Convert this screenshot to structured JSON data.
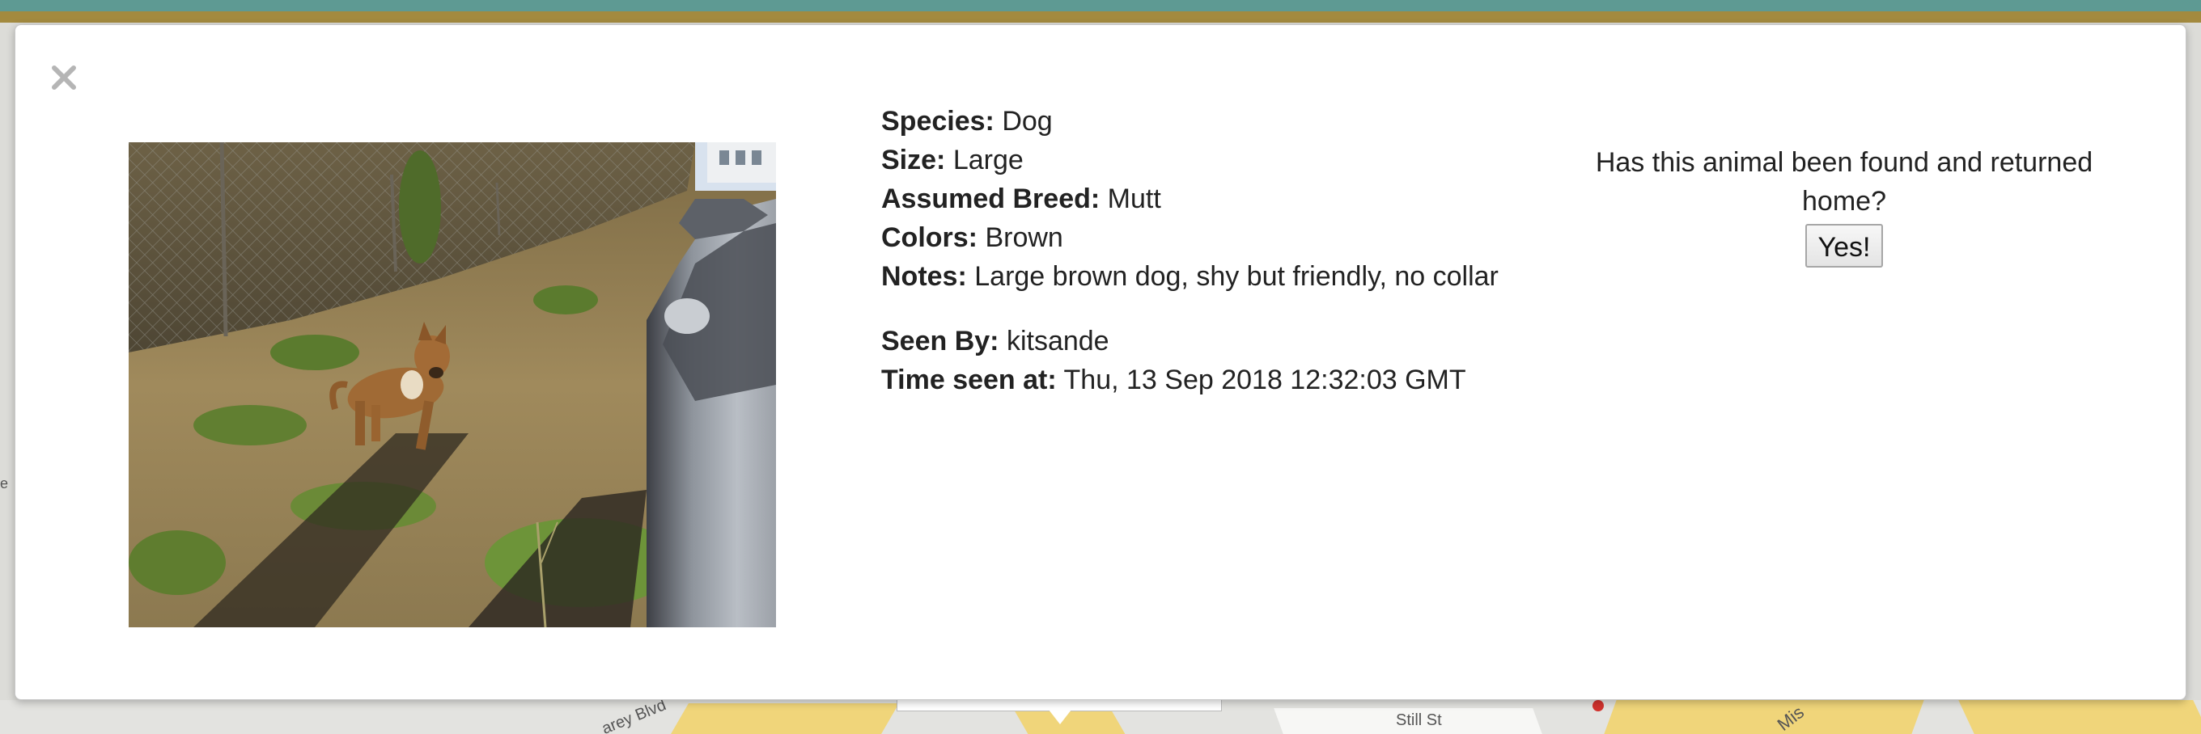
{
  "map": {
    "street_labels": [
      "Still St",
      "Mis",
      "arey Blvd",
      "e"
    ]
  },
  "modal": {
    "close_label": "×",
    "photo_alt": "Photo of a brown dog in a grassy lot next to parked cars",
    "details": {
      "species_label": "Species:",
      "species_value": "Dog",
      "size_label": "Size:",
      "size_value": "Large",
      "breed_label": "Assumed Breed:",
      "breed_value": "Mutt",
      "colors_label": "Colors:",
      "colors_value": "Brown",
      "notes_label": "Notes:",
      "notes_value": "Large brown dog, shy but friendly, no collar",
      "seen_by_label": "Seen By:",
      "seen_by_value": "kitsande",
      "time_label": "Time seen at:",
      "time_value": "Thu, 13 Sep 2018 12:32:03 GMT"
    },
    "found": {
      "question": "Has this animal been found and returned home?",
      "button_label": "Yes!"
    }
  }
}
